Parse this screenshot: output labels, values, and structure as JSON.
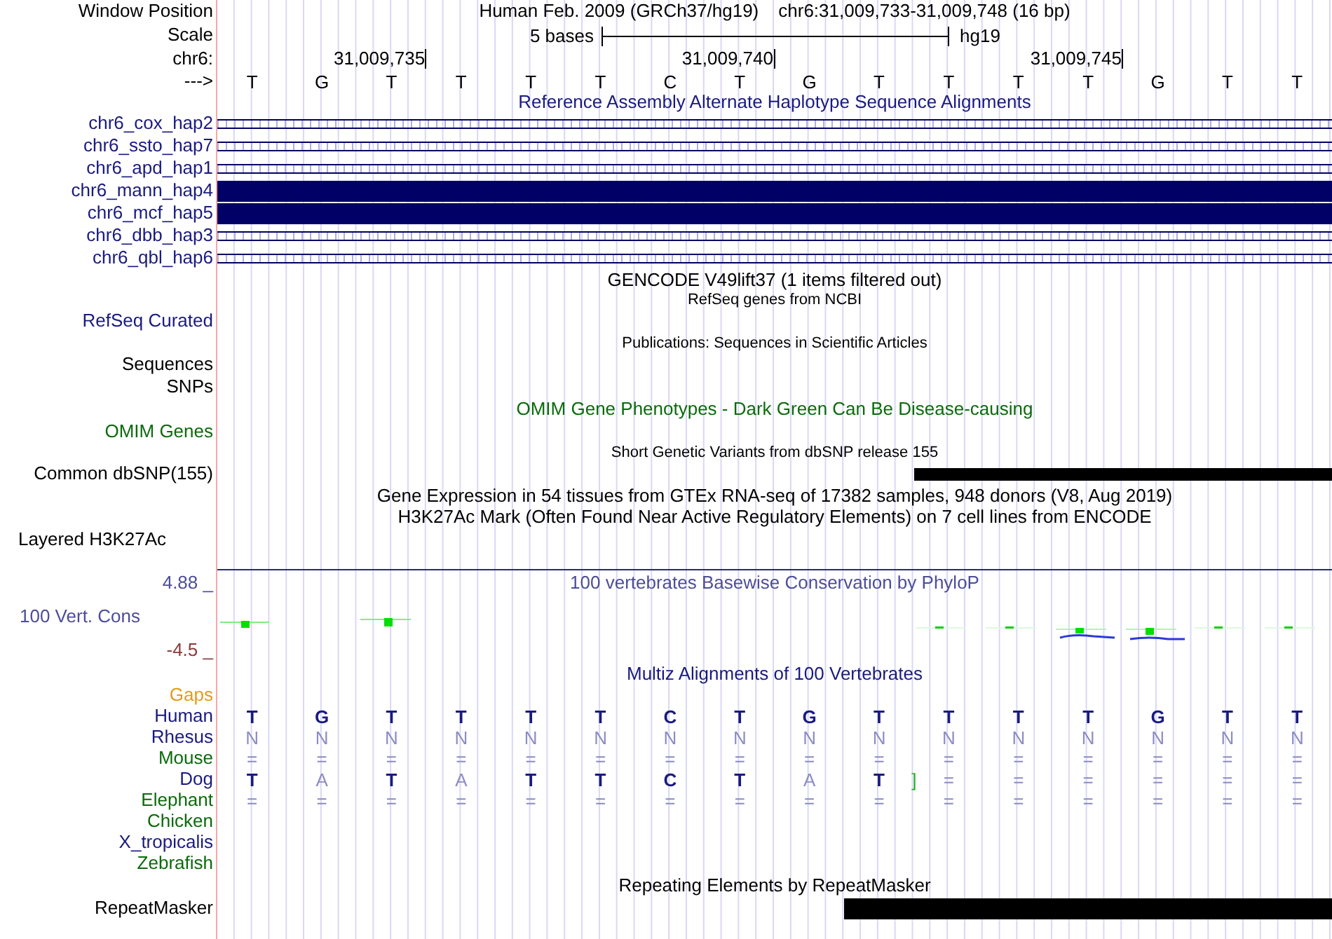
{
  "header": {
    "label": "Window Position",
    "assembly": "Human Feb. 2009 (GRCh37/hg19)",
    "position": "chr6:31,009,733-31,009,748 (16 bp)"
  },
  "scale": {
    "label": "Scale",
    "span": "5 bases",
    "assembly": "hg19"
  },
  "ruler": {
    "label": "chr6:",
    "ticks": [
      "31,009,735",
      "31,009,740",
      "31,009,745"
    ]
  },
  "sequence": {
    "label": "--->",
    "bases": [
      "T",
      "G",
      "T",
      "T",
      "T",
      "T",
      "C",
      "T",
      "G",
      "T",
      "T",
      "T",
      "T",
      "G",
      "T",
      "T"
    ]
  },
  "haplotypes": {
    "title": "Reference Assembly Alternate Haplotype Sequence Alignments",
    "items": [
      {
        "name": "chr6_cox_hap2",
        "kind": "alignment"
      },
      {
        "name": "chr6_ssto_hap7",
        "kind": "alignment"
      },
      {
        "name": "chr6_apd_hap1",
        "kind": "alignment"
      },
      {
        "name": "chr6_mann_hap4",
        "kind": "block"
      },
      {
        "name": "chr6_mcf_hap5",
        "kind": "block"
      },
      {
        "name": "chr6_dbb_hap3",
        "kind": "alignment"
      },
      {
        "name": "chr6_qbl_hap6",
        "kind": "alignment"
      }
    ]
  },
  "gencode": {
    "title": "GENCODE V49lift37 (1 items filtered out)"
  },
  "refseq": {
    "title": "RefSeq genes from NCBI",
    "label": "RefSeq Curated"
  },
  "publications": {
    "title": "Publications: Sequences in Scientific Articles",
    "labels": [
      "Sequences",
      "SNPs"
    ]
  },
  "omim": {
    "title": "OMIM Gene Phenotypes - Dark Green Can Be Disease-causing",
    "label": "OMIM Genes"
  },
  "dbsnp": {
    "title": "Short Genetic Variants from dbSNP release 155",
    "label": "Common dbSNP(155)"
  },
  "gtex": {
    "title": "Gene Expression in 54 tissues from GTEx RNA-seq of 17382 samples, 948 donors (V8, Aug 2019)"
  },
  "h3k27ac": {
    "title": "H3K27Ac Mark (Often Found Near Active Regulatory Elements) on 7 cell lines from ENCODE",
    "label": "Layered H3K27Ac"
  },
  "conservation": {
    "title": "100 vertebrates Basewise Conservation by PhyloP",
    "label": "100 Vert. Cons",
    "max": "4.88 _",
    "min": "-4.5 _"
  },
  "multiz": {
    "title": "Multiz Alignments of 100 Vertebrates",
    "gaps_label": "Gaps",
    "species": [
      {
        "name": "Human",
        "color": "#1a1a80",
        "bases": [
          {
            "text": "T",
            "dim": false
          },
          {
            "text": "G",
            "dim": false
          },
          {
            "text": "T",
            "dim": false
          },
          {
            "text": "T",
            "dim": false
          },
          {
            "text": "T",
            "dim": false
          },
          {
            "text": "T",
            "dim": false
          },
          {
            "text": "C",
            "dim": false
          },
          {
            "text": "T",
            "dim": false
          },
          {
            "text": "G",
            "dim": false
          },
          {
            "text": "T",
            "dim": false
          },
          {
            "text": "T",
            "dim": false
          },
          {
            "text": "T",
            "dim": false
          },
          {
            "text": "T",
            "dim": false
          },
          {
            "text": "G",
            "dim": false
          },
          {
            "text": "T",
            "dim": false
          },
          {
            "text": "T",
            "dim": false
          }
        ]
      },
      {
        "name": "Rhesus",
        "color": "#1a1a80",
        "bases": [
          {
            "text": "N",
            "dim": true
          },
          {
            "text": "N",
            "dim": true
          },
          {
            "text": "N",
            "dim": true
          },
          {
            "text": "N",
            "dim": true
          },
          {
            "text": "N",
            "dim": true
          },
          {
            "text": "N",
            "dim": true
          },
          {
            "text": "N",
            "dim": true
          },
          {
            "text": "N",
            "dim": true
          },
          {
            "text": "N",
            "dim": true
          },
          {
            "text": "N",
            "dim": true
          },
          {
            "text": "N",
            "dim": true
          },
          {
            "text": "N",
            "dim": true
          },
          {
            "text": "N",
            "dim": true
          },
          {
            "text": "N",
            "dim": true
          },
          {
            "text": "N",
            "dim": true
          },
          {
            "text": "N",
            "dim": true
          }
        ]
      },
      {
        "name": "Mouse",
        "color": "#0b6b0b",
        "bases": [
          {
            "text": "=",
            "dim": true
          },
          {
            "text": "=",
            "dim": true
          },
          {
            "text": "=",
            "dim": true
          },
          {
            "text": "=",
            "dim": true
          },
          {
            "text": "=",
            "dim": true
          },
          {
            "text": "=",
            "dim": true
          },
          {
            "text": "=",
            "dim": true
          },
          {
            "text": "=",
            "dim": true
          },
          {
            "text": "=",
            "dim": true
          },
          {
            "text": "=",
            "dim": true
          },
          {
            "text": "=",
            "dim": true
          },
          {
            "text": "=",
            "dim": true
          },
          {
            "text": "=",
            "dim": true
          },
          {
            "text": "=",
            "dim": true
          },
          {
            "text": "=",
            "dim": true
          },
          {
            "text": "=",
            "dim": true
          }
        ]
      },
      {
        "name": "Dog",
        "color": "#1a1a80",
        "bases": [
          {
            "kind": "base",
            "text": "T",
            "dim": false
          },
          {
            "kind": "base",
            "text": "A",
            "dim": true
          },
          {
            "kind": "base",
            "text": "T",
            "dim": false
          },
          {
            "kind": "base",
            "text": "A",
            "dim": true
          },
          {
            "kind": "base",
            "text": "T",
            "dim": false
          },
          {
            "kind": "base",
            "text": "T",
            "dim": false
          },
          {
            "kind": "base",
            "text": "C",
            "dim": false
          },
          {
            "kind": "base",
            "text": "T",
            "dim": false
          },
          {
            "kind": "base",
            "text": "A",
            "dim": true
          },
          {
            "kind": "base",
            "text": "T",
            "dim": false
          },
          {
            "kind": "insert",
            "text": "]"
          },
          {
            "kind": "base",
            "text": "=",
            "dim": true
          },
          {
            "kind": "base",
            "text": "=",
            "dim": true
          },
          {
            "kind": "base",
            "text": "=",
            "dim": true
          },
          {
            "kind": "base",
            "text": "=",
            "dim": true
          },
          {
            "kind": "base",
            "text": "=",
            "dim": true
          },
          {
            "kind": "base",
            "text": "=",
            "dim": true
          }
        ]
      },
      {
        "name": "Elephant",
        "color": "#0b6b0b",
        "bases": [
          {
            "text": "=",
            "dim": true
          },
          {
            "text": "=",
            "dim": true
          },
          {
            "text": "=",
            "dim": true
          },
          {
            "text": "=",
            "dim": true
          },
          {
            "text": "=",
            "dim": true
          },
          {
            "text": "=",
            "dim": true
          },
          {
            "text": "=",
            "dim": true
          },
          {
            "text": "=",
            "dim": true
          },
          {
            "text": "=",
            "dim": true
          },
          {
            "text": "=",
            "dim": true
          },
          {
            "text": "=",
            "dim": true
          },
          {
            "text": "=",
            "dim": true
          },
          {
            "text": "=",
            "dim": true
          },
          {
            "text": "=",
            "dim": true
          },
          {
            "text": "=",
            "dim": true
          },
          {
            "text": "=",
            "dim": true
          }
        ]
      },
      {
        "name": "Chicken",
        "color": "#0b6b0b"
      },
      {
        "name": "X_tropicalis",
        "color": "#1a1a80"
      },
      {
        "name": "Zebrafish",
        "color": "#0b6b0b"
      }
    ]
  },
  "repeatmasker": {
    "title": "Repeating Elements by RepeatMasker",
    "label": "RepeatMasker"
  }
}
